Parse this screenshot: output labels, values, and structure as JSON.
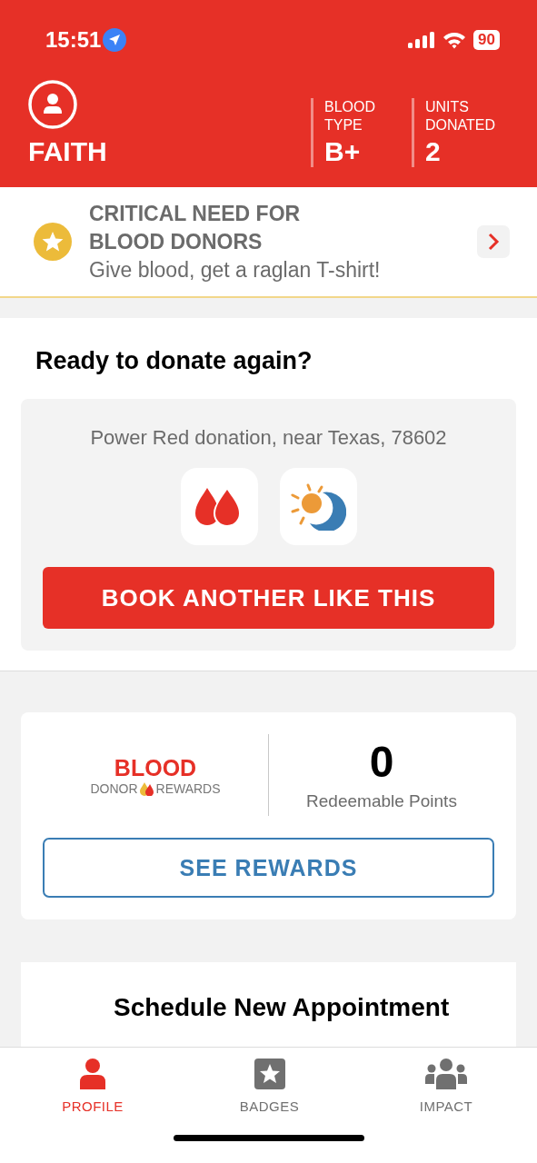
{
  "status_bar": {
    "time": "15:51",
    "battery": "90"
  },
  "profile": {
    "name": "FAITH",
    "stats": [
      {
        "label": "BLOOD TYPE",
        "value": "B+"
      },
      {
        "label": "UNITS DONATED",
        "value": "2"
      }
    ]
  },
  "promo": {
    "title": "CRITICAL NEED FOR BLOOD DONORS",
    "subtitle": "Give blood, get a raglan T-shirt!"
  },
  "donate_again": {
    "title": "Ready to donate again?",
    "description": "Power Red donation, near Texas, 78602",
    "button": "BOOK ANOTHER LIKE THIS"
  },
  "rewards": {
    "logo_title": "BLOOD",
    "logo_left": "DONOR",
    "logo_right": "REWARDS",
    "points": "0",
    "points_label": "Redeemable Points",
    "button": "SEE REWARDS"
  },
  "schedule": {
    "title": "Schedule New Appointment"
  },
  "tabs": [
    {
      "label": "PROFILE",
      "kind": "person",
      "selected": true
    },
    {
      "label": "BADGES",
      "kind": "star",
      "selected": false
    },
    {
      "label": "IMPACT",
      "kind": "group",
      "selected": false
    }
  ]
}
